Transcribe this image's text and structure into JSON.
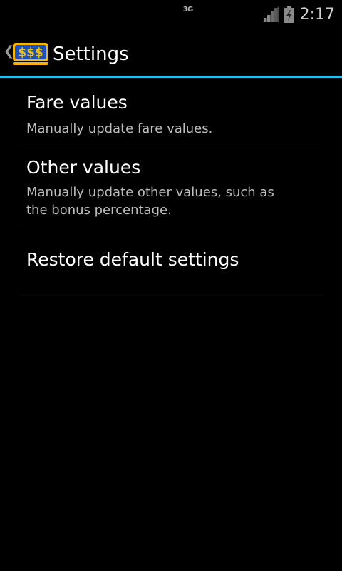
{
  "status_bar": {
    "network_type": "3G",
    "signal_icon": "signal-bars-icon",
    "battery_icon": "battery-charging-icon",
    "time": "2:17"
  },
  "action_bar": {
    "up_icon": "chevron-left-icon",
    "app_icon": "dollar-signs-icon",
    "title": "Settings",
    "accent_color": "#33b5e5"
  },
  "preferences": [
    {
      "title": "Fare values",
      "summary": "Manually update fare values."
    },
    {
      "title": "Other values",
      "summary": "Manually update other values, such as the bonus percentage."
    },
    {
      "title": "Restore default settings"
    }
  ]
}
